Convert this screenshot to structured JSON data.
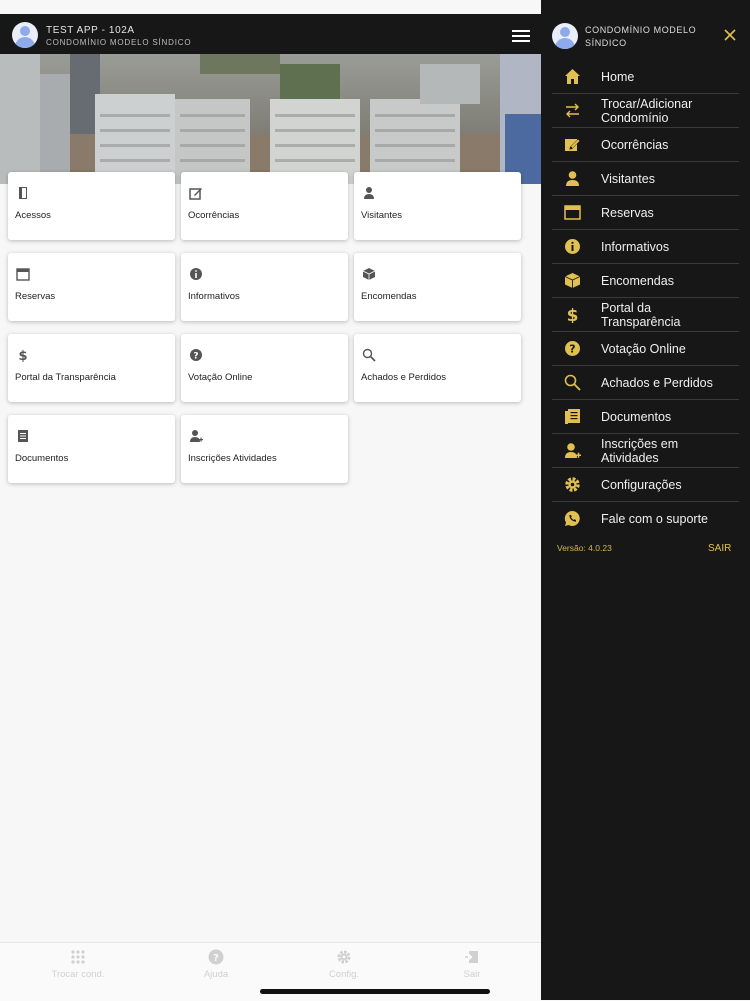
{
  "header": {
    "title": "TEST APP - 102A",
    "subtitle": "CONDOMÍNIO MODELO SÍNDICO"
  },
  "tiles": [
    {
      "label": "Acessos",
      "icon": "door-icon"
    },
    {
      "label": "Ocorrências",
      "icon": "edit-icon"
    },
    {
      "label": "Visitantes",
      "icon": "person-icon"
    },
    {
      "label": "Reservas",
      "icon": "calendar-icon"
    },
    {
      "label": "Informativos",
      "icon": "info-icon"
    },
    {
      "label": "Encomendas",
      "icon": "package-icon"
    },
    {
      "label": "Portal da Transparência",
      "icon": "dollar-icon"
    },
    {
      "label": "Votação Online",
      "icon": "help-circle-icon"
    },
    {
      "label": "Achados e Perdidos",
      "icon": "search-icon"
    },
    {
      "label": "Documentos",
      "icon": "document-icon"
    },
    {
      "label": "Inscrições Atividades",
      "icon": "person-add-icon"
    }
  ],
  "bottom_nav": [
    {
      "label": "Trocar cond.",
      "icon": "grid-icon"
    },
    {
      "label": "Ajuda",
      "icon": "help-circle-icon"
    },
    {
      "label": "Config.",
      "icon": "gear-icon"
    },
    {
      "label": "Sair",
      "icon": "logout-icon"
    }
  ],
  "drawer": {
    "title": "CONDOMÍNIO MODELO SÍNDICO",
    "items": [
      {
        "label": "Home",
        "icon": "home-icon"
      },
      {
        "label": "Trocar/Adicionar Condomínio",
        "icon": "swap-icon"
      },
      {
        "label": "Ocorrências",
        "icon": "edit-icon"
      },
      {
        "label": "Visitantes",
        "icon": "person-icon"
      },
      {
        "label": "Reservas",
        "icon": "calendar-icon"
      },
      {
        "label": "Informativos",
        "icon": "info-icon"
      },
      {
        "label": "Encomendas",
        "icon": "package-icon"
      },
      {
        "label": "Portal da Transparência",
        "icon": "dollar-icon"
      },
      {
        "label": "Votação Online",
        "icon": "help-circle-icon"
      },
      {
        "label": "Achados e Perdidos",
        "icon": "search-icon"
      },
      {
        "label": "Documentos",
        "icon": "document-icon"
      },
      {
        "label": "Inscrições em Atividades",
        "icon": "person-add-icon"
      },
      {
        "label": "Configurações",
        "icon": "gear-icon"
      },
      {
        "label": "Fale com o suporte",
        "icon": "whatsapp-icon"
      }
    ],
    "version": "Versão: 4.0.23",
    "logout": "SAIR"
  },
  "colors": {
    "accent": "#e0c050",
    "drawer_bg": "#171717",
    "tile_icon": "#555555"
  }
}
